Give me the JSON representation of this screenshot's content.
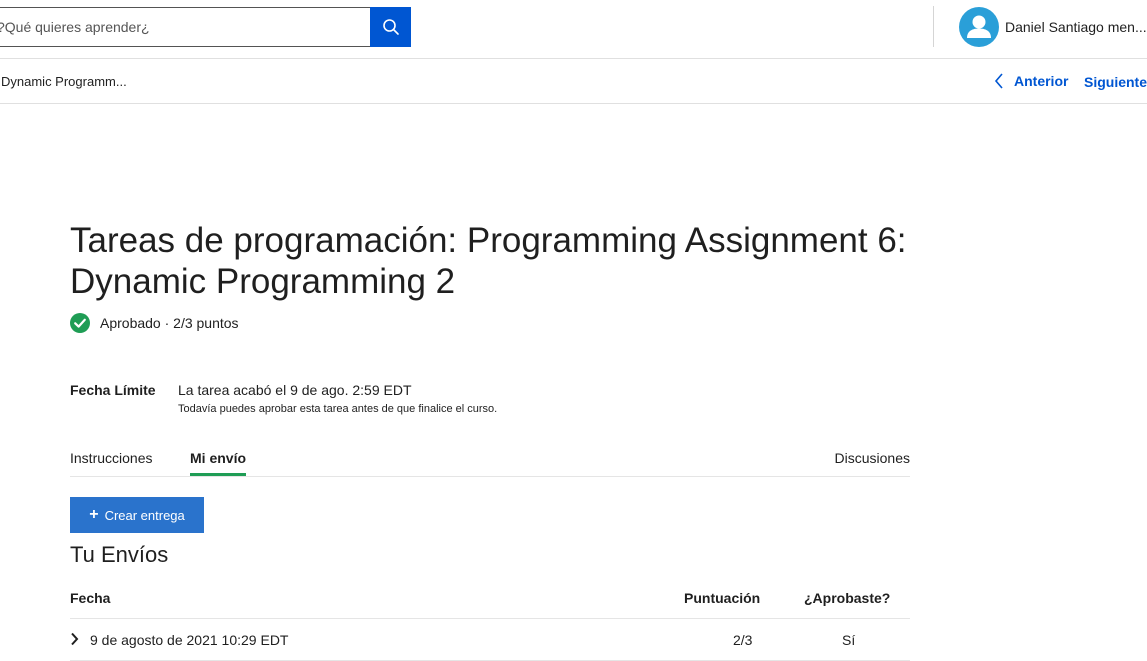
{
  "header": {
    "search_placeholder": "¿Qué quieres aprender?",
    "user_name": "Daniel Santiago men..."
  },
  "nav": {
    "breadcrumb": "Dynamic Programm...",
    "previous_label": "Anterior",
    "next_label": "Siguiente"
  },
  "assignment": {
    "title": "Tareas de programación: Programming Assignment 6: Dynamic Programming 2",
    "status": "Aprobado · 2/3 puntos",
    "deadline_label": "Fecha Límite",
    "deadline_value": "La tarea acabó el 9 de ago. 2:59 EDT",
    "deadline_note": "Todavía puedes aprobar esta tarea antes de que finalice el curso."
  },
  "tabs": [
    {
      "label": "Instrucciones",
      "active": false
    },
    {
      "label": "Mi envío",
      "active": true
    },
    {
      "label": "Discusiones",
      "active": false
    }
  ],
  "actions": {
    "create_label": "Crear entrega"
  },
  "submissions": {
    "title": "Tu Envíos",
    "columns": [
      "Fecha",
      "Puntuación",
      "¿Aprobaste?"
    ],
    "rows": [
      {
        "date": "9 de agosto de 2021 10:29 EDT",
        "score": "2/3",
        "passed": "Sí"
      }
    ]
  },
  "colors": {
    "accent_blue": "#0056d2",
    "button_blue": "#2a73cc",
    "success_green": "#1f9d55",
    "avatar_blue": "#2a9fd8"
  },
  "icons": [
    "search-icon",
    "user-icon",
    "chevron-left-icon",
    "check-circle-icon",
    "plus-icon",
    "chevron-right-icon"
  ]
}
